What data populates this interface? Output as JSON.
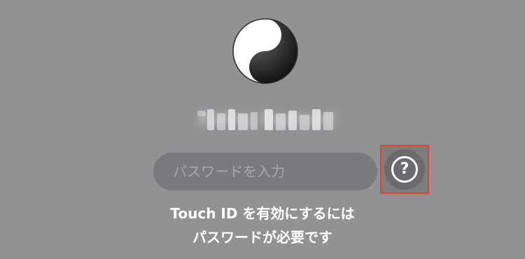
{
  "user": {
    "avatar_icon": "yin-yang-icon",
    "name": "Ashley Rowland"
  },
  "password": {
    "placeholder": "パスワードを入力",
    "value": ""
  },
  "help": {
    "icon": "question-mark-icon",
    "glyph": "?",
    "highlight_color": "#e1442a"
  },
  "message": {
    "line1": "Touch ID を有効にするには",
    "line2": "パスワードが必要です"
  },
  "colors": {
    "background": "#929295",
    "field": "#7a7a7e"
  }
}
